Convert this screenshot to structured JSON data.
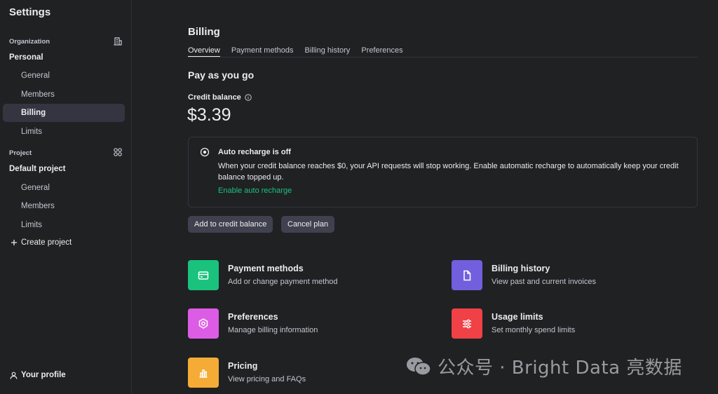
{
  "sidebar": {
    "title": "Settings",
    "organization_label": "Organization",
    "organization_name": "Personal",
    "org_items": [
      {
        "label": "General"
      },
      {
        "label": "Members"
      },
      {
        "label": "Billing"
      },
      {
        "label": "Limits"
      }
    ],
    "project_label": "Project",
    "project_name": "Default project",
    "project_items": [
      {
        "label": "General"
      },
      {
        "label": "Members"
      },
      {
        "label": "Limits"
      }
    ],
    "create_project": "Create project",
    "profile": "Your profile"
  },
  "main": {
    "title": "Billing",
    "tabs": [
      {
        "label": "Overview",
        "active": true
      },
      {
        "label": "Payment methods"
      },
      {
        "label": "Billing history"
      },
      {
        "label": "Preferences"
      }
    ],
    "section_title": "Pay as you go",
    "credit_label": "Credit balance",
    "credit_value": "$3.39",
    "notice": {
      "title": "Auto recharge is off",
      "text": "When your credit balance reaches $0, your API requests will stop working. Enable automatic recharge to automatically keep your credit balance topped up.",
      "link": "Enable auto recharge"
    },
    "buttons": {
      "add_credit": "Add to credit balance",
      "cancel_plan": "Cancel plan"
    },
    "cards": [
      {
        "title": "Payment methods",
        "desc": "Add or change payment method",
        "icon": "credit-card-icon",
        "color": "#19c37d"
      },
      {
        "title": "Billing history",
        "desc": "View past and current invoices",
        "icon": "document-icon",
        "color": "#715fde"
      },
      {
        "title": "Preferences",
        "desc": "Manage billing information",
        "icon": "gear-icon",
        "color": "#dd5ce5"
      },
      {
        "title": "Usage limits",
        "desc": "Set monthly spend limits",
        "icon": "sliders-icon",
        "color": "#ef4146"
      },
      {
        "title": "Pricing",
        "desc": "View pricing and FAQs",
        "icon": "bar-chart-icon",
        "color": "#f4ac36"
      }
    ]
  },
  "watermark": "公众号 · Bright Data 亮数据",
  "colors": {
    "background": "#202123",
    "accent_green": "#19c37d",
    "button_bg": "#40414f",
    "active_item_bg": "#343541"
  }
}
